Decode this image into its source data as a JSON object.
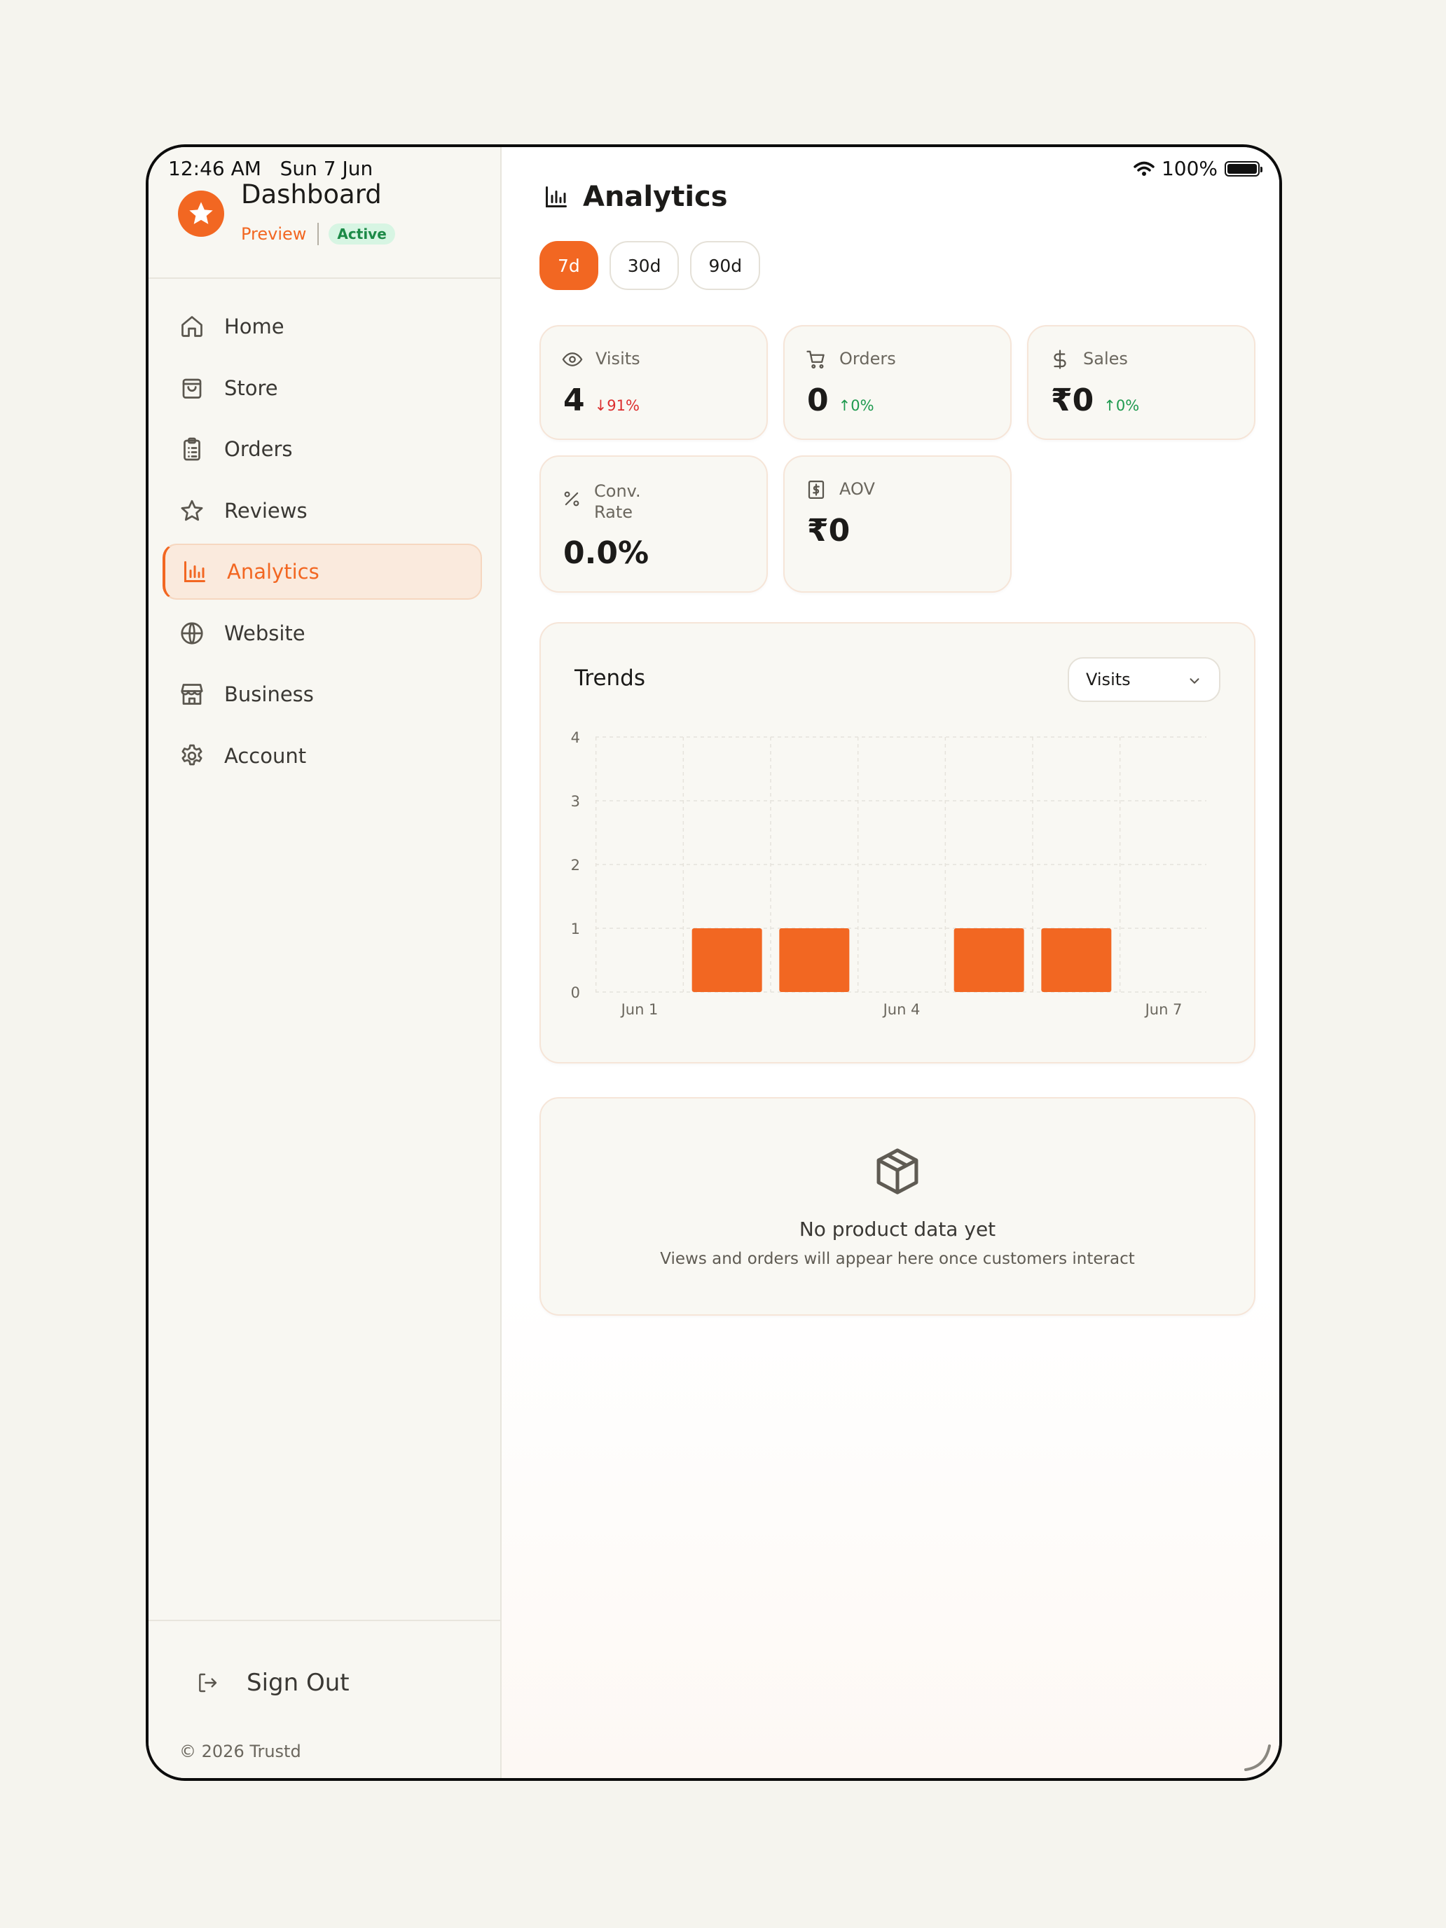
{
  "status_bar": {
    "time": "12:46 AM",
    "date": "Sun 7 Jun",
    "battery": "100%"
  },
  "sidebar": {
    "brand": {
      "title": "Dashboard",
      "preview": "Preview",
      "status": "Active"
    },
    "items": [
      {
        "label": "Home",
        "icon": "home-icon"
      },
      {
        "label": "Store",
        "icon": "shopping-bag-icon"
      },
      {
        "label": "Orders",
        "icon": "clipboard-list-icon"
      },
      {
        "label": "Reviews",
        "icon": "star-icon"
      },
      {
        "label": "Analytics",
        "icon": "bar-chart-icon",
        "active": true
      },
      {
        "label": "Website",
        "icon": "globe-icon"
      },
      {
        "label": "Business",
        "icon": "store-icon"
      },
      {
        "label": "Account",
        "icon": "gear-icon"
      }
    ],
    "sign_out": "Sign Out",
    "copyright": "© 2026 Trustd"
  },
  "main": {
    "title": "Analytics",
    "ranges": [
      "7d",
      "30d",
      "90d"
    ],
    "selected_range": "7d",
    "stats": {
      "visits": {
        "label": "Visits",
        "value": "4",
        "delta": "91%",
        "delta_direction": "down"
      },
      "orders": {
        "label": "Orders",
        "value": "0",
        "delta": "0%",
        "delta_direction": "up"
      },
      "sales": {
        "label": "Sales",
        "value": "₹0",
        "delta": "0%",
        "delta_direction": "up"
      },
      "conv_rate": {
        "label_line1": "Conv.",
        "label_line2": "Rate",
        "value": "0.0%"
      },
      "aov": {
        "label": "AOV",
        "value": "₹0"
      }
    },
    "trends": {
      "title": "Trends",
      "metric": "Visits"
    },
    "empty_products": {
      "title": "No product data yet",
      "description": "Views and orders will appear here once customers interact"
    }
  },
  "colors": {
    "accent": "#f26722",
    "success": "#1f9a4f",
    "danger": "#dc2f2f",
    "chat": "#22c05a"
  },
  "chart_data": {
    "type": "bar",
    "categories": [
      "Jun 1",
      "Jun 2",
      "Jun 3",
      "Jun 4",
      "Jun 5",
      "Jun 6",
      "Jun 7"
    ],
    "values": [
      0,
      1,
      1,
      0,
      1,
      1,
      0
    ],
    "tick_labels": [
      "Jun 1",
      "Jun 4",
      "Jun 7"
    ],
    "y_ticks": [
      "0",
      "1",
      "2",
      "3",
      "4"
    ],
    "ylim": [
      0,
      4
    ],
    "grid": true,
    "color": "#f26722"
  }
}
